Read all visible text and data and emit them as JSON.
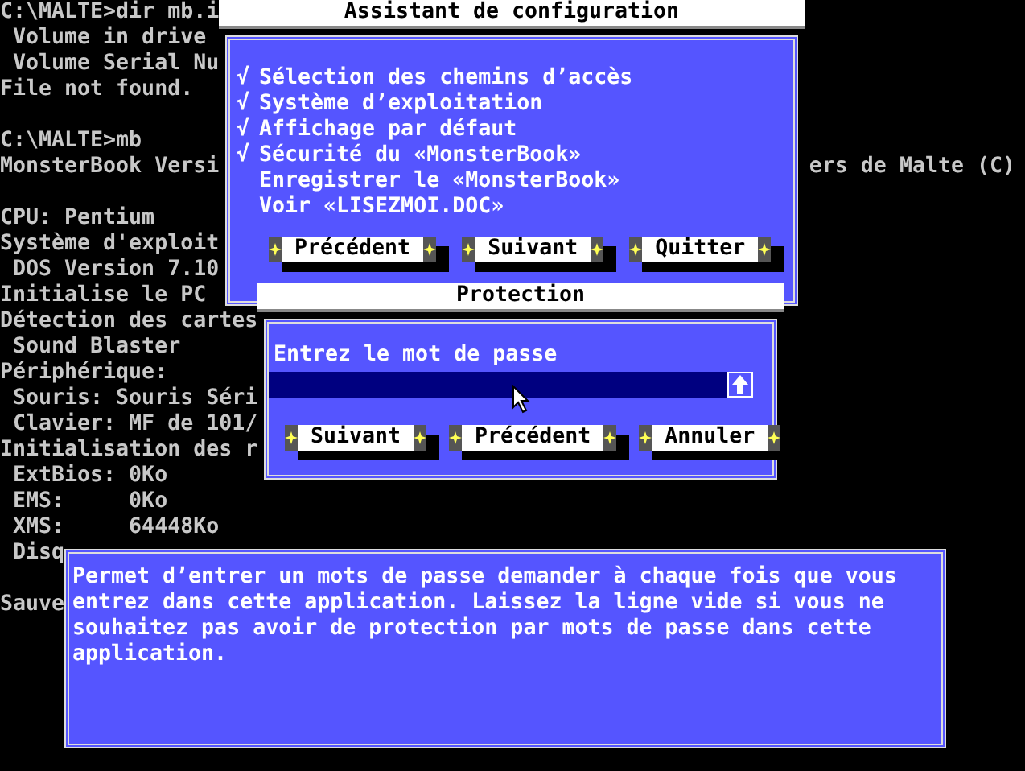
{
  "console": {
    "blocks": [
      [
        {
          "text": "C:\\MALTE>dir mb.i"
        },
        {
          "text": " Volume in drive"
        },
        {
          "text": " Volume Serial Nu"
        },
        {
          "text": "File not found."
        }
      ],
      [
        {
          "text": "C:\\MALTE>mb"
        },
        {
          "text": "MonsterBook Versi",
          "tail": "ers de Malte (C)"
        }
      ],
      [
        {
          "text": "CPU: Pentium"
        },
        {
          "text": "Système d'exploit"
        },
        {
          "text": " DOS Version 7.10"
        },
        {
          "text": "Initialise le PC"
        },
        {
          "text": "Détection des cartes"
        },
        {
          "text": " Sound Blaster"
        },
        {
          "text": "Périphérique:"
        },
        {
          "text": " Souris: Souris Séri"
        },
        {
          "text": " Clavier: MF de 101/"
        },
        {
          "text": "Initialisation des r"
        },
        {
          "text": " ExtBios: 0Ko"
        },
        {
          "text": " EMS:     0Ko"
        },
        {
          "text": " XMS:     64448Ko"
        },
        {
          "text": " Disq"
        }
      ],
      [
        {
          "text": "Sauve"
        }
      ]
    ]
  },
  "wizard": {
    "title": "Assistant de configuration",
    "items": [
      {
        "label": "Sélection des chemins d’accès",
        "checked": true
      },
      {
        "label": "Système d’exploitation",
        "checked": true
      },
      {
        "label": "Affichage par défaut",
        "checked": true
      },
      {
        "label": "Sécurité du «MonsterBook»",
        "checked": true
      },
      {
        "label": "Enregistrer le «MonsterBook»",
        "checked": false
      },
      {
        "label": "Voir «LISEZMOI.DOC»",
        "checked": false
      }
    ],
    "check_mark": "√",
    "buttons": [
      "Précédent",
      "Suivant",
      "Quitter"
    ]
  },
  "protection": {
    "title": "Protection",
    "prompt": "Entrez le mot de passe",
    "buttons": [
      "Suivant",
      "Précédent",
      "Annuler"
    ]
  },
  "help": {
    "text": "Permet d’entrer un mots de passe demander à chaque fois que vous entrez dans cette application. Laissez la ligne vide si vous ne souhaitez pas avoir de protection par mots de passe dans cette application."
  }
}
